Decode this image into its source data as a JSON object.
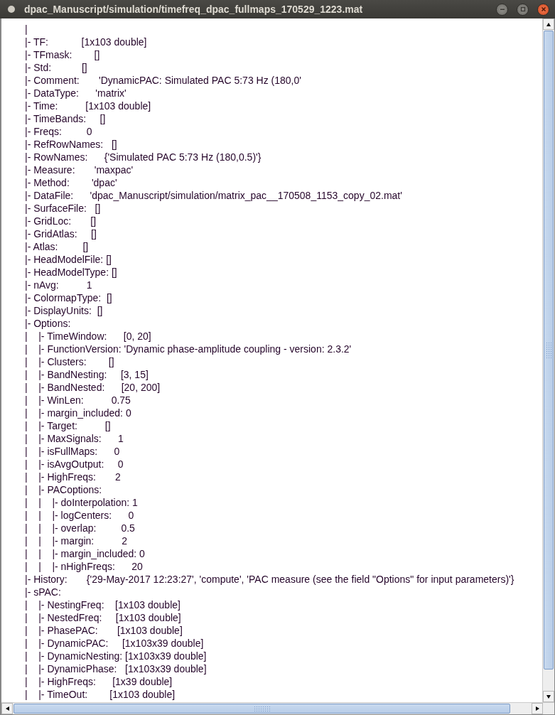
{
  "window": {
    "title": "dpac_Manuscript/simulation/timefreq_dpac_fullmaps_170529_1223.mat"
  },
  "lines": [
    "|",
    "|- TF:            [1x103 double]",
    "|- TFmask:        []",
    "|- Std:           []",
    "|- Comment:       'DynamicPAC: Simulated PAC 5:73 Hz (180,0'",
    "|- DataType:      'matrix'",
    "|- Time:          [1x103 double]",
    "|- TimeBands:     []",
    "|- Freqs:         0",
    "|- RefRowNames:   []",
    "|- RowNames:      {'Simulated PAC 5:73 Hz (180,0.5)'}",
    "|- Measure:       'maxpac'",
    "|- Method:        'dpac'",
    "|- DataFile:      'dpac_Manuscript/simulation/matrix_pac__170508_1153_copy_02.mat'",
    "|- SurfaceFile:   []",
    "|- GridLoc:       []",
    "|- GridAtlas:     []",
    "|- Atlas:         []",
    "|- HeadModelFile: []",
    "|- HeadModelType: []",
    "|- nAvg:          1",
    "|- ColormapType:  []",
    "|- DisplayUnits:  []",
    "|- Options:",
    "|    |- TimeWindow:      [0, 20]",
    "|    |- FunctionVersion: 'Dynamic phase-amplitude coupling - version: 2.3.2'",
    "|    |- Clusters:        []",
    "|    |- BandNesting:     [3, 15]",
    "|    |- BandNested:      [20, 200]",
    "|    |- WinLen:          0.75",
    "|    |- margin_included: 0",
    "|    |- Target:          []",
    "|    |- MaxSignals:      1",
    "|    |- isFullMaps:      0",
    "|    |- isAvgOutput:     0",
    "|    |- HighFreqs:       2",
    "|    |- PACoptions:",
    "|    |    |- doInterpolation: 1",
    "|    |    |- logCenters:      0",
    "|    |    |- overlap:         0.5",
    "|    |    |- margin:          2",
    "|    |    |- margin_included: 0",
    "|    |    |- nHighFreqs:      20",
    "|- History:       {'29-May-2017 12:23:27', 'compute', 'PAC measure (see the field \"Options\" for input parameters)'}",
    "|- sPAC:",
    "|    |- NestingFreq:    [1x103 double]",
    "|    |- NestedFreq:     [1x103 double]",
    "|    |- PhasePAC:       [1x103 double]",
    "|    |- DynamicPAC:     [1x103x39 double]",
    "|    |- DynamicNesting: [1x103x39 double]",
    "|    |- DynamicPhase:   [1x103x39 double]",
    "|    |- HighFreqs:      [1x39 double]",
    "|    |- TimeOut:        [1x103 double]"
  ]
}
